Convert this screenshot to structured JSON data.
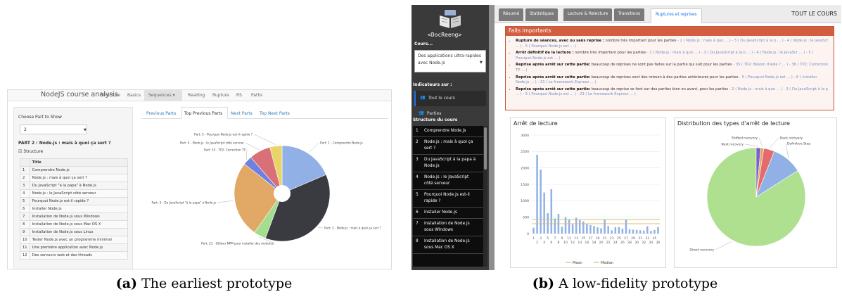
{
  "proto_a": {
    "brand": "NodeJS course analysis",
    "nav": [
      "Structure",
      "Basics",
      "Sequences ▾",
      "Reading",
      "Rupture",
      "RS",
      "Paths"
    ],
    "choose_label": "Choose Part to Show",
    "select_value": "2",
    "part_title": "PART 2 : Node.js : mais à quoi ça sert ?",
    "structure_label": "Structure",
    "table_header": "Title",
    "table_rows": [
      {
        "n": "1",
        "t": "Comprendre Node.js"
      },
      {
        "n": "2",
        "t": "Node.js : mais à quoi ça sert ?"
      },
      {
        "n": "3",
        "t": "Du JavaScript \"à la papa\" à Node.js"
      },
      {
        "n": "4",
        "t": "Node.js : le JavaScript côté serveur"
      },
      {
        "n": "5",
        "t": "Pourquoi Node.js est-il rapide ?"
      },
      {
        "n": "6",
        "t": "Installer Node.js"
      },
      {
        "n": "7",
        "t": "Installation de Node.js sous Windows"
      },
      {
        "n": "8",
        "t": "Installation de Node.js sous Mac OS X"
      },
      {
        "n": "9",
        "t": "Installation de Node.js sous Linux"
      },
      {
        "n": "10",
        "t": "Tester Node.js avec un programme minimal"
      },
      {
        "n": "11",
        "t": "Une première application avec Node.js"
      },
      {
        "n": "12",
        "t": "Des serveurs web et des threads"
      }
    ],
    "tabs": [
      "Previous Parts",
      "Top Previous Parts",
      "Next Parts",
      "Top Next Parts"
    ],
    "pie": {
      "type": "pie",
      "slices": [
        {
          "label": "Part: 1 - Comprendre Node.js",
          "value": 18,
          "color": "#91b1e6"
        },
        {
          "label": "Part: 2 - Node.js : mais à quoi ça sert ?",
          "value": 36,
          "color": "#3a3a41"
        },
        {
          "label": "Part: 21 - Utiliser NPM pour installer des modules",
          "value": 4,
          "color": "#a5dd8f"
        },
        {
          "label": "Part: 3 - Du JavaScript \"à la papa\" à Node.js",
          "value": 25,
          "color": "#e2a866"
        },
        {
          "label": "Part: 35 - TP2: Correction TP",
          "value": 3,
          "color": "#7080e0"
        },
        {
          "label": "Part: 4 - Node.js : le JavaScript côté serveur",
          "value": 7,
          "color": "#d96f77"
        },
        {
          "label": "Part: 5 - Pourquoi Node.js est-il rapide ?",
          "value": 4,
          "color": "#e9d46a"
        }
      ]
    }
  },
  "proto_b": {
    "logo_text": "<DocReeng>",
    "cours_label": "Cours...",
    "select_value": "Des applications ultra-rapides avec Node.js",
    "indicateurs_label": "Indicateurs sur :",
    "indicateurs": [
      "Tout le cours",
      "Parties"
    ],
    "structure_label": "Structure du cours",
    "structure": [
      {
        "n": "1",
        "t": "Comprendre Node.js"
      },
      {
        "n": "2",
        "t": "Node.js : mais à quoi ça sert ?"
      },
      {
        "n": "3",
        "t": "Du JavaScript à la papa à Node.js"
      },
      {
        "n": "4",
        "t": "Node.js : le JavaScript côté serveur"
      },
      {
        "n": "5",
        "t": "Pourquoi Node.js est-il rapide ?"
      },
      {
        "n": "6",
        "t": "Installer Node.js"
      },
      {
        "n": "7",
        "t": "Installation de Node.js sous Windows"
      },
      {
        "n": "8",
        "t": "Installation de Node.js sous Mac OS X"
      }
    ],
    "tabs": [
      "Résumé",
      "Statistiques",
      "Lecture & Relecture",
      "Transitions",
      "Ruptures et reprises"
    ],
    "tout_le_cours": "TOUT LE COURS",
    "faits_title": "Faits importants",
    "faits": [
      {
        "head": "Rupture de séances, avec ou sans reprise :",
        "body": " nombre très important pour les parties ",
        "links": "- 2 ( Node.js : mais à quo ... ) - 3 ( Du JavaScript à la p ... ) - 4 ( Node.js : le JavaScr ... ) - 5 ( Pourquoi Node.js est ... )"
      },
      {
        "head": "Arrêt définitif de la lecture :",
        "body": " nombre très important pour les parties ",
        "links": "- 2 ( Node.js : mais à quo ... ) - 3 ( Du JavaScript à la p ... ) - 4 ( Node.js : le JavaScr ... ) - 5 ( Pourquoi Node.js est ... )"
      },
      {
        "head": "Reprise après arrêt sur cette partie:",
        "body": " beaucoup de reprises ne sont pas faites sur la partie qui suit pour les parties ",
        "links": "- 35 ( TP2: Besoin d'aide ? ... ) - 36 ( TP2: Correction TP ... )"
      },
      {
        "head": "Reprise après arrêt sur cette partie:",
        "body": " beaucoup de reprises sont des retours à des parties antérieures pour les parties ",
        "links": "- 5 ( Pourquoi Node.js est ... ) - 6 ( Installer Node.js ... ) - 23 ( Le framework Express ... )"
      },
      {
        "head": "Reprise après arrêt sur cette partie:",
        "body": " beaucoup de reprise se font sur des parties bien en avant, pour les parties ",
        "links": "- 2 ( Node.js : mais à quo ... ) - 3 ( Du JavaScript à la p ... ) - 5 ( Pourquoi Node.js est ... ) - 23 ( Le framework Express ... )"
      }
    ],
    "bar_title": "Arrêt de lecture",
    "pie_title": "Distribution des types d'arrêt de lecture"
  },
  "chart_data": [
    {
      "type": "bar",
      "title": "Arrêt de lecture",
      "x": [
        1,
        2,
        3,
        4,
        5,
        6,
        7,
        8,
        9,
        10,
        11,
        12,
        13,
        14,
        15,
        16,
        17,
        18,
        19,
        20,
        21,
        22,
        23,
        24,
        25,
        26,
        27,
        28,
        29,
        30,
        31,
        32,
        33,
        34,
        35,
        36
      ],
      "tick_labels_top": [
        "1",
        "3",
        "5",
        "7",
        "9",
        "11",
        "13",
        "15",
        "17",
        "19",
        "21",
        "23",
        "25",
        "27",
        "29",
        "31",
        "33",
        "35"
      ],
      "tick_labels_bottom": [
        "2",
        "4",
        "6",
        "8",
        "10",
        "12",
        "14",
        "16",
        "18",
        "20",
        "22",
        "24",
        "26",
        "28",
        "30",
        "32",
        "34",
        "36"
      ],
      "yticks": [
        0,
        500,
        1000,
        1500,
        2000,
        2500,
        3000
      ],
      "ylim": [
        0,
        3000
      ],
      "series": [
        {
          "name": "bars",
          "values": [
            180,
            2400,
            1950,
            1250,
            620,
            1350,
            460,
            600,
            210,
            500,
            420,
            280,
            480,
            410,
            370,
            300,
            260,
            230,
            190,
            160,
            420,
            230,
            100,
            190,
            200,
            150,
            420,
            130,
            120,
            110,
            100,
            90,
            220,
            80,
            110,
            200
          ]
        }
      ],
      "mean": 428,
      "median": 300,
      "legend": [
        {
          "name": "Mean",
          "color": "#b8cc78"
        },
        {
          "name": "Median",
          "color": "#eab676"
        }
      ]
    },
    {
      "type": "pie",
      "title": "Distribution des types d'arrêt de lecture",
      "slices": [
        {
          "label": "Direct recovery",
          "value": 84,
          "color": "#aee090"
        },
        {
          "label": "Next recovery",
          "value": 1.5,
          "color": "#7a62c6"
        },
        {
          "label": "Shifted recovery",
          "value": 1,
          "color": "#e2a866"
        },
        {
          "label": "Back recovery",
          "value": 3.5,
          "color": "#e36b6b"
        },
        {
          "label": "Definitive Stop",
          "value": 10,
          "color": "#91b1e6"
        }
      ]
    }
  ],
  "captions": {
    "a_letter": "(a)",
    "a_text": "The earliest prototype",
    "b_letter": "(b)",
    "b_text": "A low-fidelity prototype"
  }
}
